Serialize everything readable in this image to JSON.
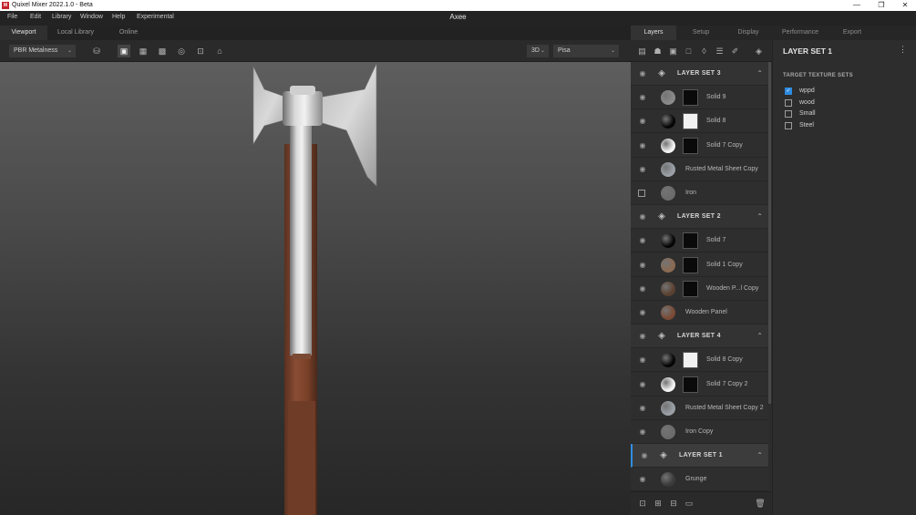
{
  "window": {
    "app_title": "Quixel Mixer 2022.1.0 - Beta",
    "app_icon_text": "M",
    "document_title": "Axee",
    "minimize_glyph": "—",
    "maximize_glyph": "❐",
    "close_glyph": "✕"
  },
  "menu": {
    "items": [
      "File",
      "Edit",
      "Library",
      "Window",
      "Help",
      "Experimental"
    ]
  },
  "viewport_tabs": [
    "Viewport",
    "Local Library",
    "Online"
  ],
  "viewport_toolbar": {
    "shading_mode": "PBR Metalness",
    "view_mode": "3D",
    "environment": "Pisa",
    "caret": "⌄"
  },
  "right_tabs": [
    "Layers",
    "Setup",
    "Display",
    "Performance",
    "Export"
  ],
  "layers": [
    {
      "kind": "group",
      "name": "LAYER SET 3"
    },
    {
      "kind": "layer",
      "name": "Solid 9",
      "swatch": "#8a8a8a",
      "mask": "dark",
      "visible": true
    },
    {
      "kind": "layer",
      "name": "Solid 8",
      "swatch": "#050505",
      "mask": "light",
      "visible": true
    },
    {
      "kind": "layer",
      "name": "Solid 7 Copy",
      "swatch": "#f4f4f4",
      "mask": "dark",
      "visible": true
    },
    {
      "kind": "layer",
      "name": "Rusted Metal Sheet Copy",
      "swatch": "#9aa0a6",
      "mask": "none",
      "visible": true
    },
    {
      "kind": "layer",
      "name": "Iron",
      "swatch": "#6b6b6b",
      "mask": "none",
      "visible": false
    },
    {
      "kind": "group",
      "name": "LAYER SET 2"
    },
    {
      "kind": "layer",
      "name": "Solid 7",
      "swatch": "#050505",
      "mask": "dark",
      "visible": true
    },
    {
      "kind": "layer",
      "name": "Solid 1 Copy",
      "swatch": "#8b6a52",
      "mask": "dark",
      "visible": true
    },
    {
      "kind": "layer",
      "name": "Wooden P...l Copy",
      "swatch": "#5a4030",
      "mask": "dark",
      "visible": true
    },
    {
      "kind": "layer",
      "name": "Wooden Panel",
      "swatch": "#7a4a34",
      "mask": "none",
      "visible": true
    },
    {
      "kind": "group",
      "name": "LAYER SET 4"
    },
    {
      "kind": "layer",
      "name": "Solid 8 Copy",
      "swatch": "#050505",
      "mask": "light",
      "visible": true
    },
    {
      "kind": "layer",
      "name": "Solid 7 Copy 2",
      "swatch": "#f4f4f4",
      "mask": "dark",
      "visible": true
    },
    {
      "kind": "layer",
      "name": "Rusted Metal Sheet Copy 2",
      "swatch": "#9aa0a6",
      "mask": "none",
      "visible": true
    },
    {
      "kind": "layer",
      "name": "Iron Copy",
      "swatch": "#6b6b6b",
      "mask": "none",
      "visible": true
    },
    {
      "kind": "group",
      "name": "LAYER SET 1",
      "selected": true
    },
    {
      "kind": "layer",
      "name": "Grunge",
      "swatch": "#3a3a3a",
      "mask": "none",
      "visible": true
    }
  ],
  "properties": {
    "title": "LAYER SET 1",
    "menu_glyph": "⋮",
    "section": "TARGET TEXTURE SETS",
    "check_glyph": "✓",
    "texture_sets": [
      {
        "name": "wppd",
        "checked": true
      },
      {
        "name": "wood",
        "checked": false
      },
      {
        "name": "Small",
        "checked": false
      },
      {
        "name": "Steel",
        "checked": false
      }
    ]
  },
  "icons": {
    "eye": "◉",
    "group": "◈",
    "collapse": "⌃",
    "toolbar": [
      "▤",
      "☗",
      "▣",
      "□",
      "◊",
      "☰",
      "✐",
      "◈"
    ],
    "bottom": [
      "⊡",
      "⊞",
      "⊟",
      "▭",
      "🗑"
    ],
    "view": [
      "⛁",
      "▣",
      "▦",
      "▩",
      "◎",
      "⊡",
      "⌂"
    ]
  }
}
